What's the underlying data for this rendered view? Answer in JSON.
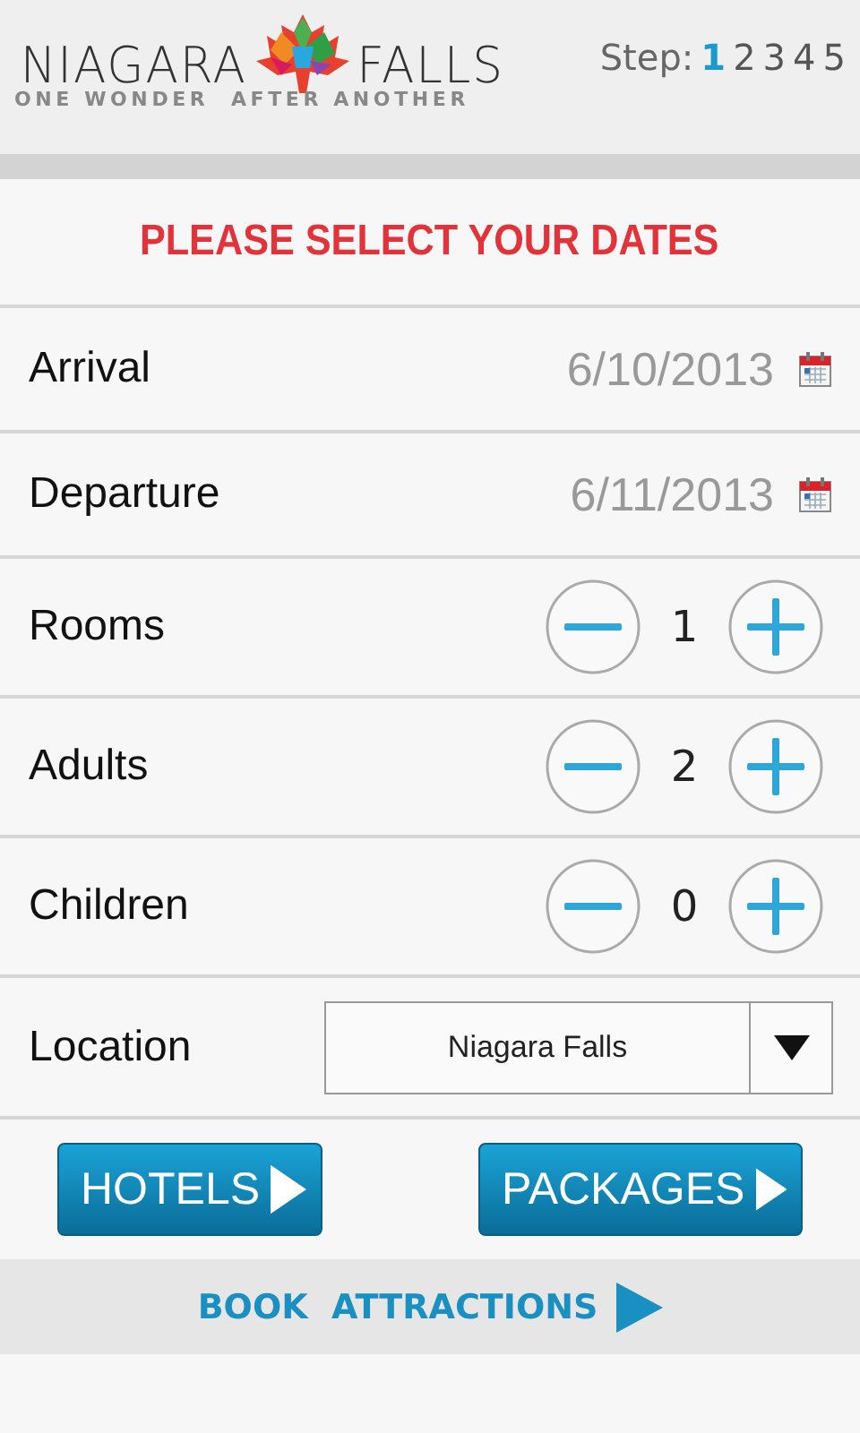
{
  "header": {
    "logo": {
      "word_1": "NIAGARA",
      "word_2": "FALLS",
      "tagline": "ONE WONDER  AFTER ANOTHER"
    },
    "step_label": "Step:",
    "steps": [
      {
        "label": "1",
        "selected": true
      },
      {
        "label": "2",
        "selected": false
      },
      {
        "label": "3",
        "selected": false
      },
      {
        "label": "4",
        "selected": false
      },
      {
        "label": "5",
        "selected": false
      }
    ]
  },
  "title": "PLEASE SELECT YOUR DATES",
  "fields": [
    {
      "kind": "date",
      "label": "Arrival",
      "value": "6/10/2013"
    },
    {
      "kind": "date",
      "label": "Departure",
      "value": "6/11/2013"
    },
    {
      "kind": "counter",
      "label": "Rooms",
      "value": "1"
    },
    {
      "kind": "counter",
      "label": "Adults",
      "value": "2"
    },
    {
      "kind": "counter",
      "label": "Children",
      "value": "0"
    },
    {
      "kind": "select",
      "label": "Location",
      "value": "Niagara Falls"
    }
  ],
  "buttons": [
    {
      "label": "HOTELS"
    },
    {
      "label": "PACKAGES"
    }
  ],
  "footer_link": "BOOK  ATTRACTIONS"
}
